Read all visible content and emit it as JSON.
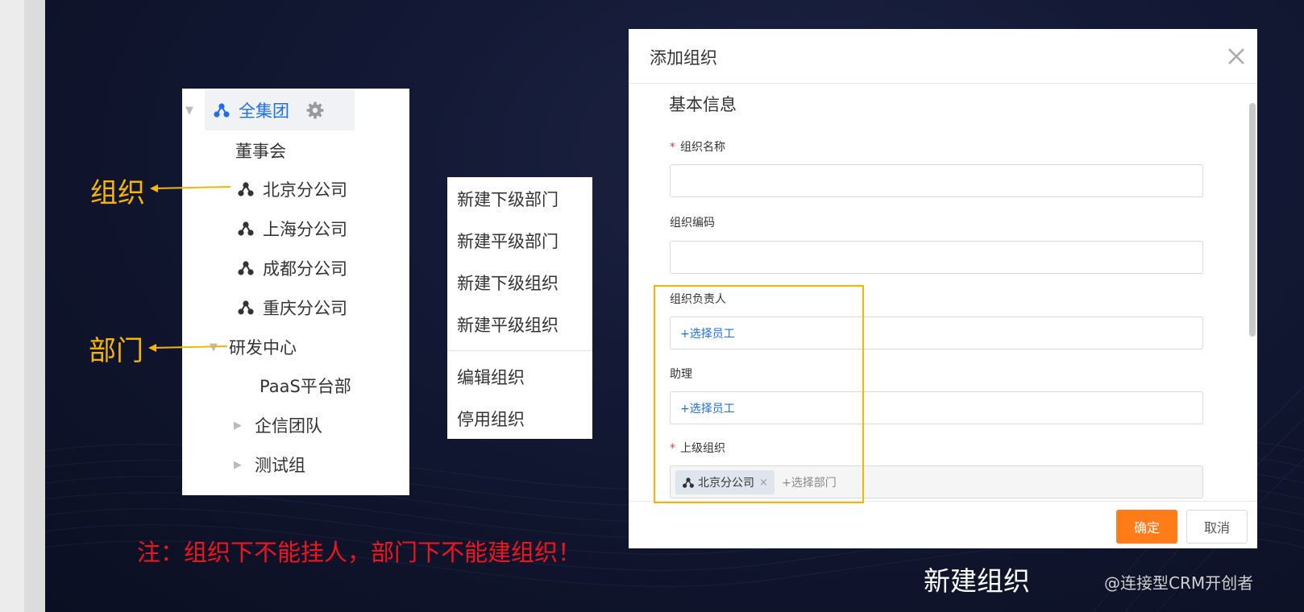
{
  "tree": {
    "root_label": "全集团",
    "items": [
      {
        "label": "董事会"
      },
      {
        "label": "北京分公司"
      },
      {
        "label": "上海分公司"
      },
      {
        "label": "成都分公司"
      },
      {
        "label": "重庆分公司"
      },
      {
        "label": "研发中心"
      },
      {
        "label": "PaaS平台部"
      },
      {
        "label": "企信团队"
      },
      {
        "label": "测试组"
      }
    ]
  },
  "annotations": {
    "org": "组织",
    "dept": "部门"
  },
  "context_menu": {
    "items": [
      {
        "label": "新建下级部门"
      },
      {
        "label": "新建平级部门"
      },
      {
        "label": "新建下级组织"
      },
      {
        "label": "新建平级组织"
      },
      {
        "label": "编辑组织"
      },
      {
        "label": "停用组织"
      }
    ]
  },
  "dialog": {
    "title": "添加组织",
    "section_title": "基本信息",
    "fields": {
      "org_name": {
        "label": "组织名称",
        "required": "*"
      },
      "org_code": {
        "label": "组织编码"
      },
      "org_leader": {
        "label": "组织负责人",
        "picker": "+选择员工"
      },
      "assistant": {
        "label": "助理",
        "picker": "+选择员工"
      },
      "parent_org": {
        "label": "上级组织",
        "required": "*",
        "tag": "北京分公司",
        "tag_close": "×",
        "picker": "+选择部门"
      }
    },
    "buttons": {
      "ok": "确定",
      "cancel": "取消"
    }
  },
  "note": "注：组织下不能挂人，部门下不能建组织！",
  "caption": "新建组织",
  "watermark": "@连接型CRM开创者",
  "colors": {
    "accent": "#1d6ef2",
    "annotation": "#f7b500",
    "note": "#f0141e",
    "primary_button": "#ff7c19"
  }
}
